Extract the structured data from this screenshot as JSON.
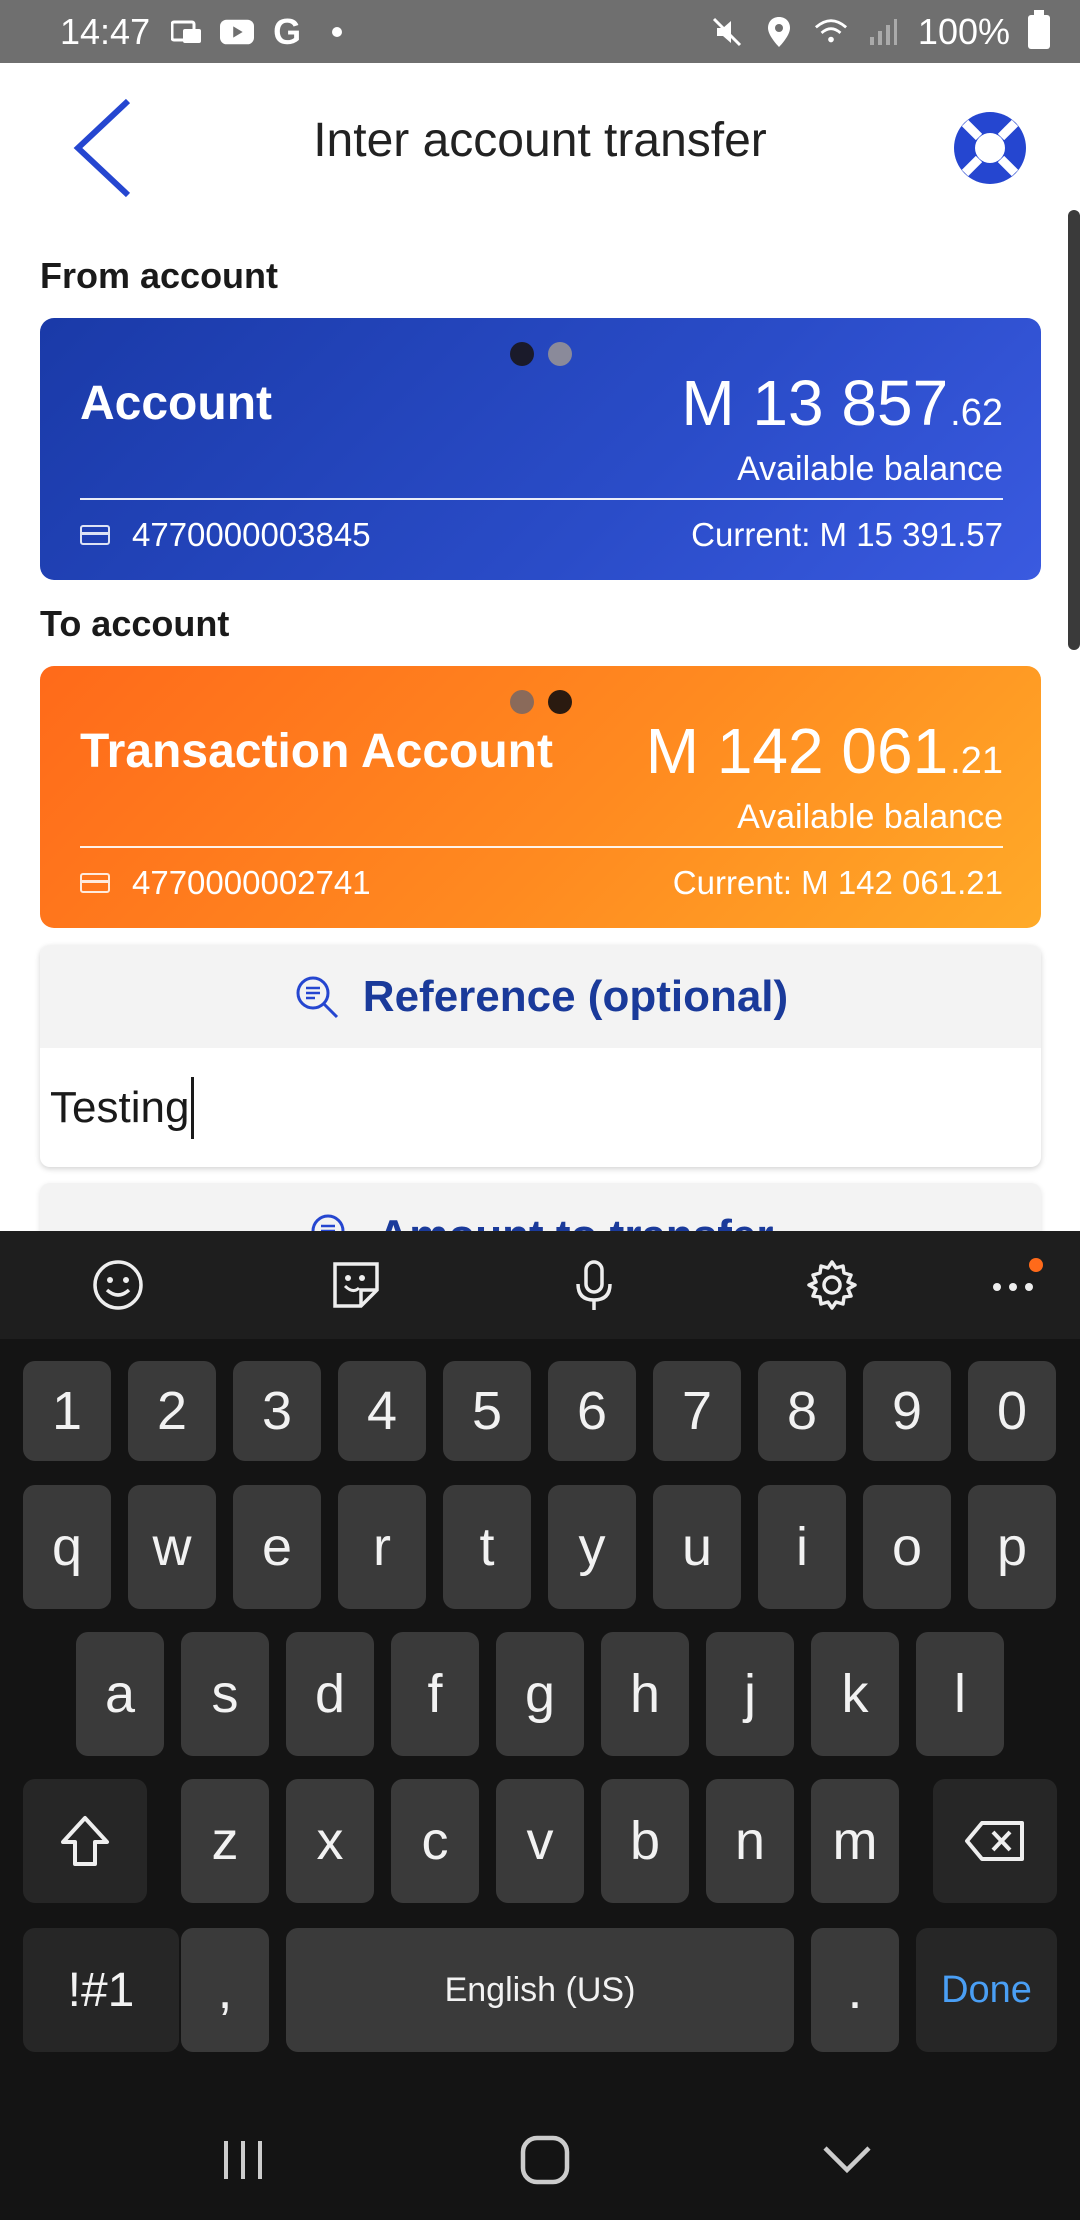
{
  "status_bar": {
    "time": "14:47",
    "battery": "100%",
    "icons": [
      "message-icon",
      "youtube-icon",
      "google-icon",
      "dot-icon",
      "mute-icon",
      "location-icon",
      "wifi-icon",
      "signal-icon",
      "battery-icon"
    ]
  },
  "header": {
    "title": "Inter account transfer",
    "back_icon": "chevron-left-icon",
    "help_icon": "lifebuoy-icon"
  },
  "from_account": {
    "label": "From account",
    "name": "Account",
    "amount_main": "M 13 857",
    "amount_cents": ".62",
    "available_label": "Available balance",
    "account_number": "4770000003845",
    "current": "Current: M 15 391.57",
    "color": "#2340bc"
  },
  "to_account": {
    "label": "To account",
    "name": "Transaction Account",
    "amount_main": "M 142 061",
    "amount_cents": ".21",
    "available_label": "Available balance",
    "account_number": "4770000002741",
    "current": "Current: M 142 061.21",
    "color": "#ff8a20"
  },
  "reference": {
    "title": "Reference (optional)",
    "value": "Testing"
  },
  "amount": {
    "title": "Amount to transfer"
  },
  "keyboard": {
    "numbers": [
      "1",
      "2",
      "3",
      "4",
      "5",
      "6",
      "7",
      "8",
      "9",
      "0"
    ],
    "row1": [
      "q",
      "w",
      "e",
      "r",
      "t",
      "y",
      "u",
      "i",
      "o",
      "p"
    ],
    "row2": [
      "a",
      "s",
      "d",
      "f",
      "g",
      "h",
      "j",
      "k",
      "l"
    ],
    "row3": [
      "z",
      "x",
      "c",
      "v",
      "b",
      "n",
      "m"
    ],
    "symbols_key": "!#1",
    "comma_key": ",",
    "space_label": "English (US)",
    "period_key": ".",
    "done_label": "Done"
  },
  "colors": {
    "accent_blue": "#1a3a9a",
    "done_blue": "#4a9ff5"
  }
}
